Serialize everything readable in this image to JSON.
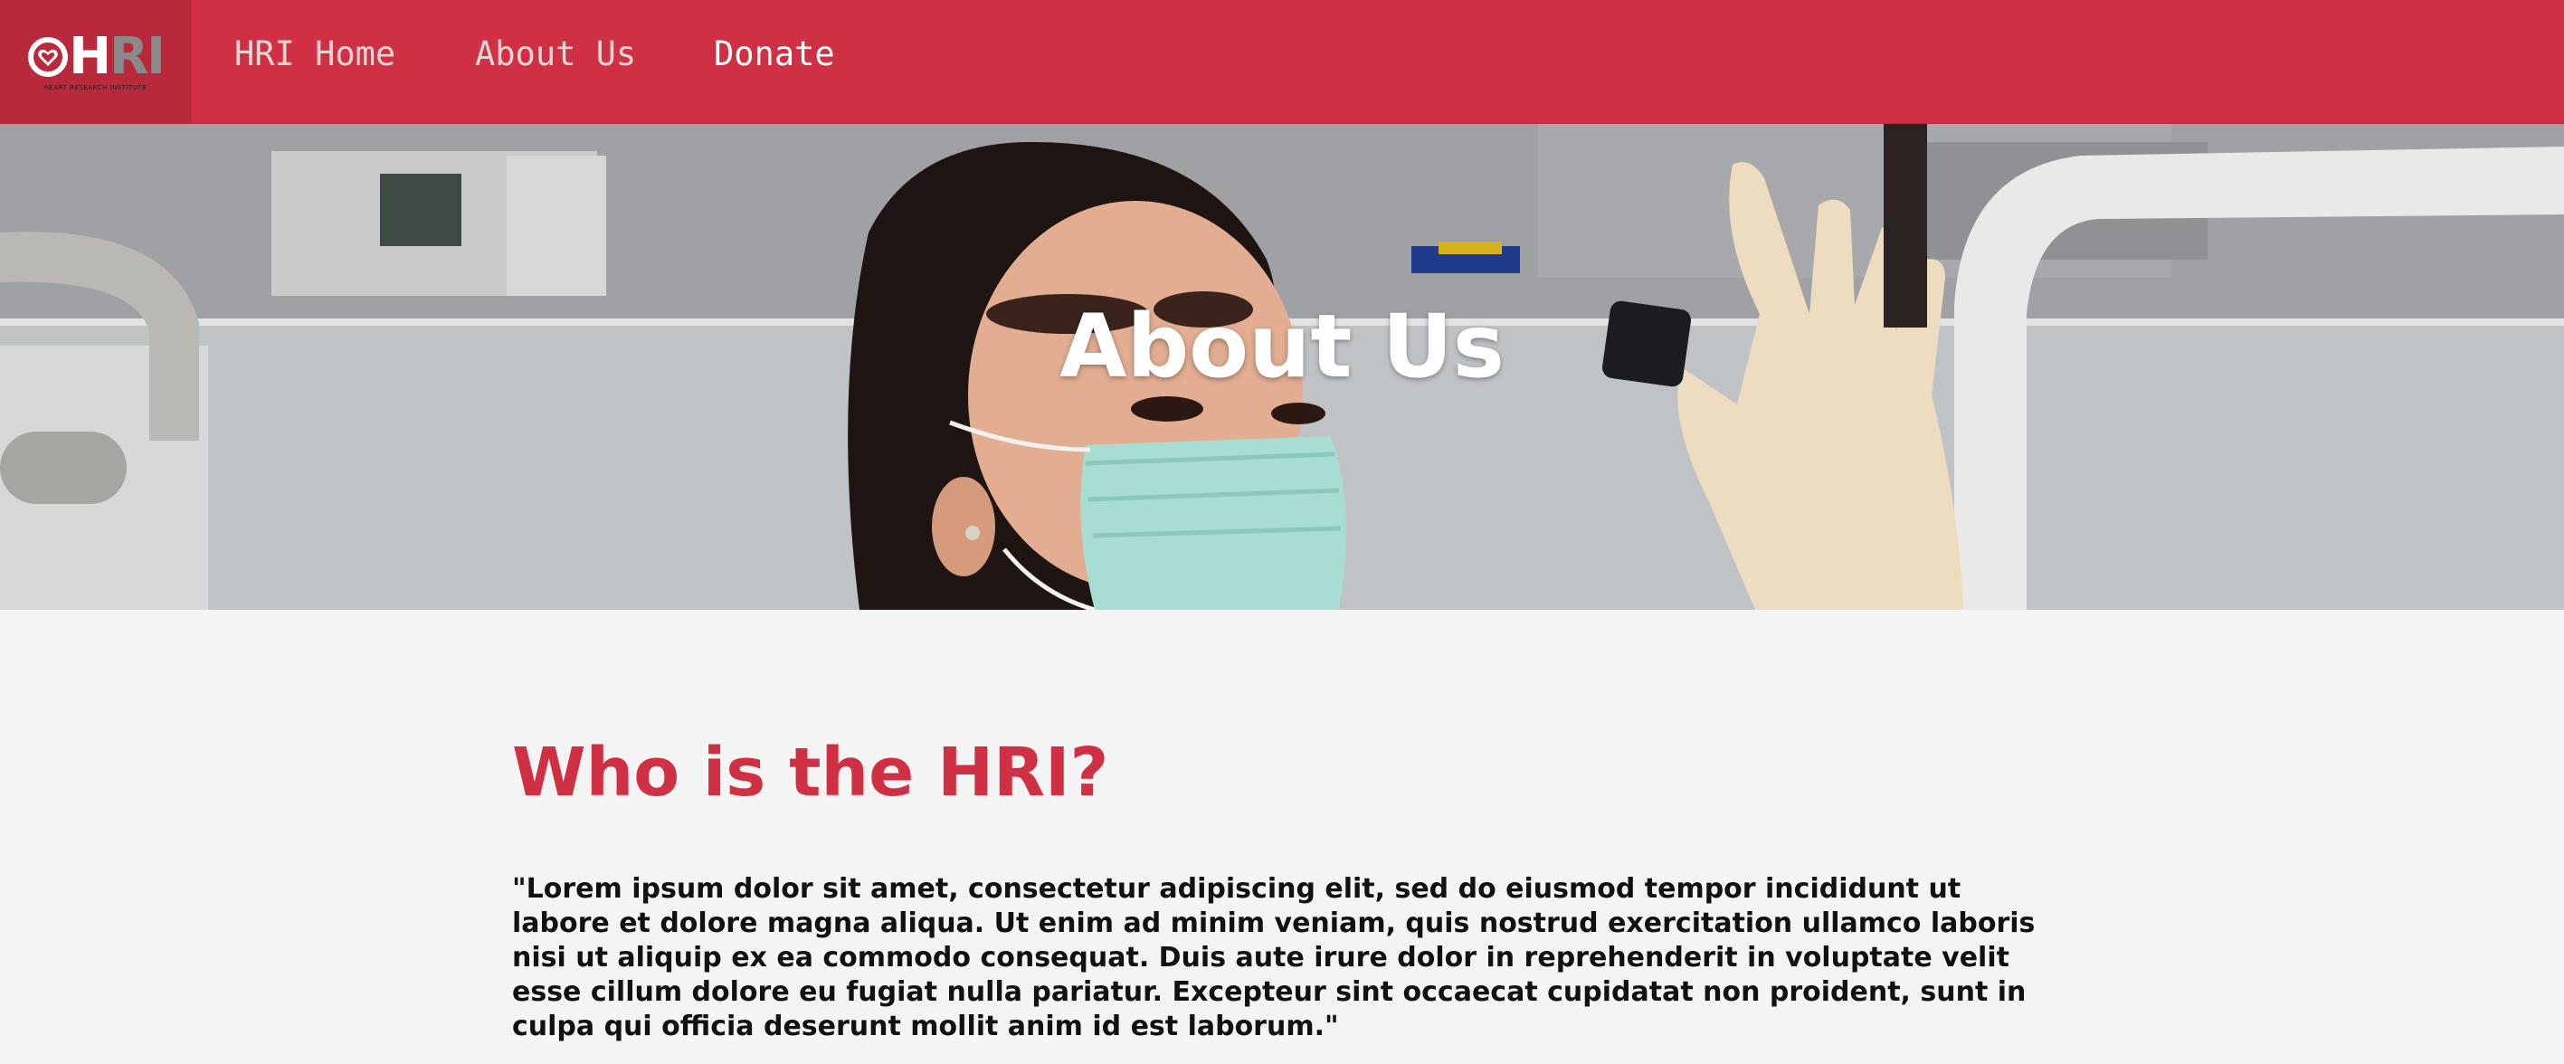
{
  "nav": {
    "logo_text_h": "H",
    "logo_text_ri": "RI",
    "logo_subtitle": "HEART RESEARCH INSTITUTE",
    "links": [
      {
        "label": "HRI Home"
      },
      {
        "label": "About Us"
      },
      {
        "label": "Donate"
      }
    ]
  },
  "hero": {
    "title": "About Us"
  },
  "main": {
    "heading": "Who is the HRI?",
    "body": "\"Lorem ipsum dolor sit amet, consectetur adipiscing elit, sed do eiusmod tempor incididunt ut labore et dolore magna aliqua. Ut enim ad minim veniam, quis nostrud exercitation ullamco laboris nisi ut aliquip ex ea commodo consequat. Duis aute irure dolor in reprehenderit in voluptate velit esse cillum dolore eu fugiat nulla pariatur. Excepteur sint occaecat cupidatat non proident, sunt in culpa qui officia deserunt mollit anim id est laborum.\""
  },
  "colors": {
    "brand_red": "#d03043",
    "logo_bg": "#b82a3b",
    "page_bg": "#f4f4f4"
  },
  "icons": {
    "logo": "heart-logo-icon"
  }
}
